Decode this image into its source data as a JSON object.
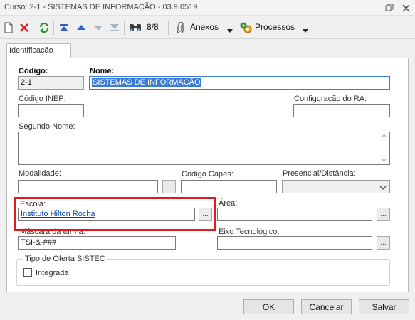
{
  "window": {
    "title": "Curso: 2-1 - SISTEMAS DE INFORMAÇÃO - 03.9.0519"
  },
  "toolbar": {
    "record_counter": "8/8",
    "anexos_label": "Anexos",
    "processos_label": "Processos"
  },
  "tabs": [
    {
      "label": "Identificação",
      "active": true
    }
  ],
  "form": {
    "codigo": {
      "label": "Código:",
      "value": "2-1"
    },
    "nome": {
      "label": "Nome:",
      "value": "SISTEMAS DE INFORMAÇÃO"
    },
    "codigo_inep": {
      "label": "Código INEP:",
      "value": ""
    },
    "config_ra": {
      "label": "Configuração do RA:",
      "value": ""
    },
    "segundo_nome": {
      "label": "Segundo Nome:",
      "value": ""
    },
    "modalidade": {
      "label": "Modalidade:",
      "value": "",
      "button": "..."
    },
    "codigo_capes": {
      "label": "Código Capes:",
      "value": ""
    },
    "presencial": {
      "label": "Presencial/Distância:",
      "value": ""
    },
    "escola": {
      "label": "Escola:",
      "value": "Instituto Hilton Rocha",
      "button": "..."
    },
    "area": {
      "label": "Área:",
      "value": "",
      "button": "..."
    },
    "mascara": {
      "label": "Máscara da turma:",
      "value": "TSI-&-###"
    },
    "eixo": {
      "label": "Eixo Tecnológico:",
      "value": "",
      "button": "..."
    },
    "tipo_oferta": {
      "label": "Tipo de Oferta SISTEC",
      "checkbox_label": "Integrada",
      "checked": false
    }
  },
  "footer": {
    "ok": "OK",
    "cancelar": "Cancelar",
    "salvar": "Salvar"
  },
  "colors": {
    "highlight": "#e01b1b",
    "selection": "#3b7bd6",
    "link": "#0645ad"
  }
}
